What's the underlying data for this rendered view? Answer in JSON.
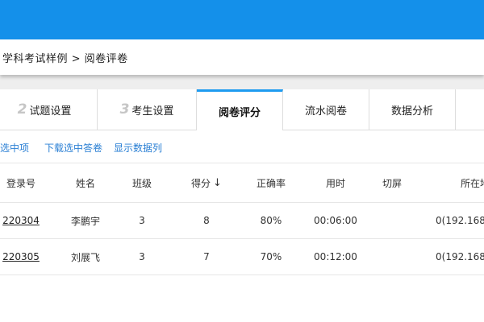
{
  "breadcrumb": {
    "text": "学科考试样例 > 阅卷评卷"
  },
  "tabs": [
    {
      "num": "2",
      "label": "试题设置"
    },
    {
      "num": "3",
      "label": "考生设置"
    },
    {
      "num": "",
      "label": "阅卷评分"
    },
    {
      "num": "",
      "label": "流水阅卷"
    },
    {
      "num": "",
      "label": "数据分析"
    }
  ],
  "toolbar": {
    "delete_selected": "删除选中项",
    "download_selected": "下载选中答卷",
    "show_columns": "显示数据列"
  },
  "table": {
    "headers": [
      "登录号",
      "姓名",
      "班级",
      "得分",
      "正确率",
      "用时",
      "切屏",
      "所在地"
    ],
    "sort_icon": "↓",
    "rows": [
      [
        "220304",
        "李鹏宇",
        "3",
        "8",
        "80%",
        "00:06:00",
        "",
        "0(192.168."
      ],
      [
        "220305",
        "刘展飞",
        "3",
        "7",
        "70%",
        "00:12:00",
        "",
        "0(192.168."
      ]
    ]
  },
  "colors": {
    "header_blue": "#1490ea",
    "link_blue": "#2a7fd4",
    "active_tab_accent": "#1e9bf0"
  }
}
